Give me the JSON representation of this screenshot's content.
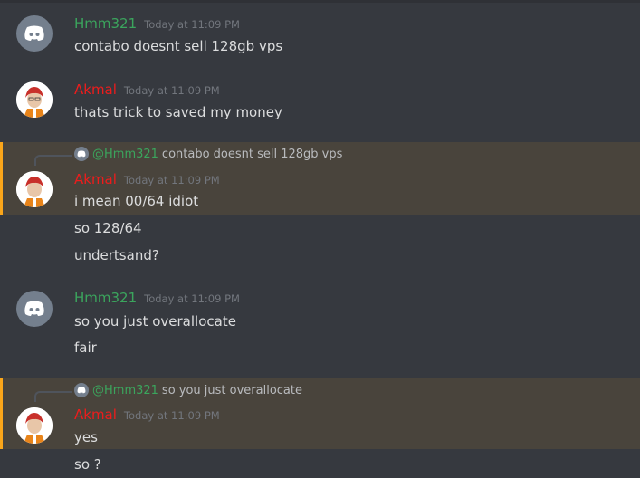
{
  "colors": {
    "hmm": "#3ba55d",
    "akmal": "#ed1c1c",
    "accent": "#faa61a"
  },
  "messages": [
    {
      "author": "Hmm321",
      "timestamp": "Today at 11:09 PM",
      "lines": [
        "contabo doesnt sell 128gb vps"
      ]
    },
    {
      "author": "Akmal",
      "timestamp": "Today at 11:09 PM",
      "lines": [
        "thats trick to saved my money"
      ]
    },
    {
      "author": "Akmal",
      "timestamp": "Today at 11:09 PM",
      "reply": {
        "mention": "@Hmm321",
        "text": "contabo doesnt sell 128gb vps"
      },
      "lines": [
        "i mean 00/64 idiot",
        "so 128/64",
        "undertsand?"
      ]
    },
    {
      "author": "Hmm321",
      "timestamp": "Today at 11:09 PM",
      "lines": [
        "so you just overallocate",
        "fair"
      ]
    },
    {
      "author": "Akmal",
      "timestamp": "Today at 11:09 PM",
      "reply": {
        "mention": "@Hmm321",
        "text": "so you just overallocate"
      },
      "lines": [
        "yes",
        "so ?"
      ]
    }
  ]
}
